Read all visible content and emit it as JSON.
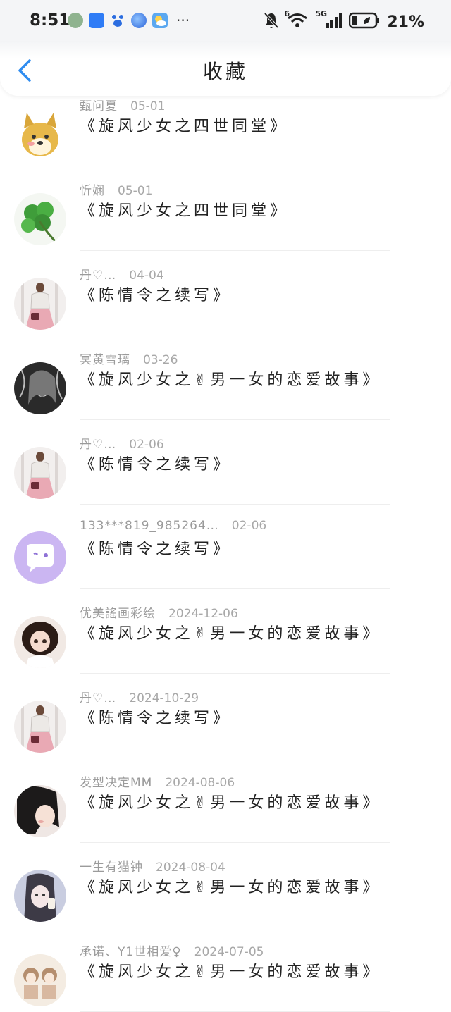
{
  "status_bar": {
    "time": "8:51",
    "more": "···",
    "network": "5G",
    "signal_badge": "6",
    "battery": "21%"
  },
  "header": {
    "title": "收藏",
    "back_icon": "chevron-left-icon"
  },
  "colors": {
    "accent": "#2f8cf0",
    "text": "#222222",
    "meta": "#9b9b9b"
  },
  "items": [
    {
      "user": "甄问夏",
      "date": "05-01",
      "title": "《旋风少女之四世同堂》",
      "avatar": "doge"
    },
    {
      "user": "忻娴",
      "date": "05-01",
      "title": "《旋风少女之四世同堂》",
      "avatar": "clover"
    },
    {
      "user": "丹♡…",
      "date": "04-04",
      "title": "《陈情令之续写》",
      "avatar": "girl-pink"
    },
    {
      "user": "冥黄雪璃",
      "date": "03-26",
      "title": "《旋风少女之✌男一女的恋爱故事》",
      "avatar": "dark-girl"
    },
    {
      "user": "丹♡…",
      "date": "02-06",
      "title": "《陈情令之续写》",
      "avatar": "girl-pink"
    },
    {
      "user": "133***819_985264…",
      "date": "02-06",
      "title": "《陈情令之续写》",
      "avatar": "chat-bubble"
    },
    {
      "user": "优美謠画彩绘",
      "date": "2024-12-06",
      "title": "《旋风少女之✌男一女的恋爱故事》",
      "avatar": "doll"
    },
    {
      "user": "丹♡…",
      "date": "2024-10-29",
      "title": "《陈情令之续写》",
      "avatar": "girl-pink"
    },
    {
      "user": "发型决定MM",
      "date": "2024-08-06",
      "title": "《旋风少女之✌男一女的恋爱故事》",
      "avatar": "hair-girl"
    },
    {
      "user": "一生有猫钟",
      "date": "2024-08-04",
      "title": "《旋风少女之✌男一女的恋爱故事》",
      "avatar": "selfie-girl"
    },
    {
      "user": "承诺、Y1世相爱♀",
      "date": "2024-07-05",
      "title": "《旋风少女之✌男一女的恋爱故事》",
      "avatar": "sketch"
    }
  ]
}
